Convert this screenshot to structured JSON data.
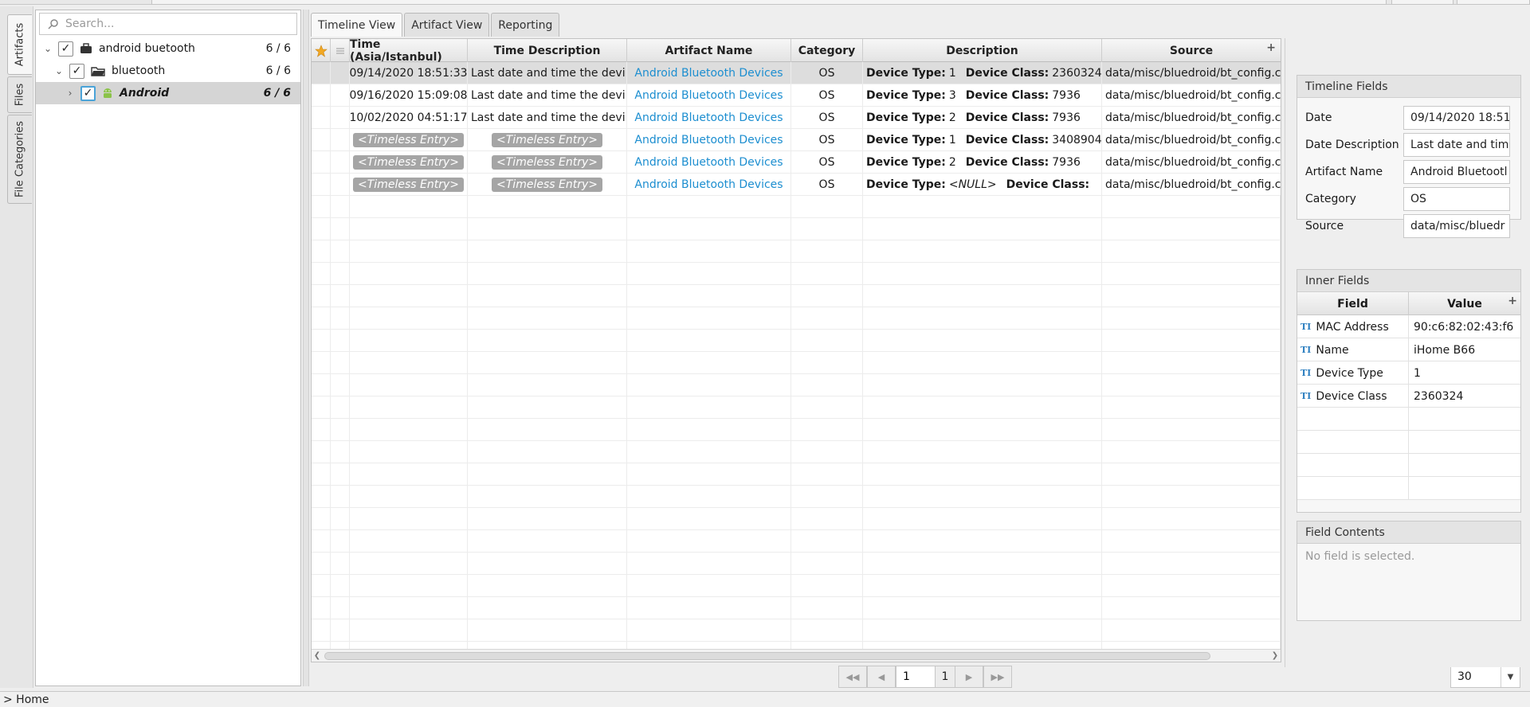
{
  "sidebar_tabs": [
    "Artifacts",
    "Files",
    "File Categories"
  ],
  "search": {
    "placeholder": "Search..."
  },
  "tree": [
    {
      "label": "android buetooth",
      "count": "6 / 6"
    },
    {
      "label": "bluetooth",
      "count": "6 / 6"
    },
    {
      "label": "Android",
      "count": "6 / 6"
    }
  ],
  "tabs": [
    "Timeline View",
    "Artifact View",
    "Reporting"
  ],
  "table": {
    "headers": [
      "Time (Asia/Istanbul)",
      "Time Description",
      "Artifact Name",
      "Category",
      "Description",
      "Source"
    ],
    "rows": [
      {
        "time": "09/14/2020 18:51:33",
        "time_desc": "Last date and time the devi...",
        "artifact": "Android Bluetooth Devices",
        "category": "OS",
        "dt_label": "Device Type:",
        "dt_value": "1",
        "dc_label": "Device Class:",
        "dc_value": "2360324",
        "source": "data/misc/bluedroid/bt_config.co"
      },
      {
        "time": "09/16/2020 15:09:08",
        "time_desc": "Last date and time the devi...",
        "artifact": "Android Bluetooth Devices",
        "category": "OS",
        "dt_label": "Device Type:",
        "dt_value": "3",
        "dc_label": "Device Class:",
        "dc_value": "7936",
        "source": "data/misc/bluedroid/bt_config.co"
      },
      {
        "time": "10/02/2020 04:51:17",
        "time_desc": "Last date and time the devi...",
        "artifact": "Android Bluetooth Devices",
        "category": "OS",
        "dt_label": "Device Type:",
        "dt_value": "2",
        "dc_label": "Device Class:",
        "dc_value": "7936",
        "source": "data/misc/bluedroid/bt_config.co"
      },
      {
        "time": "<Timeless Entry>",
        "time_desc": "<Timeless Entry>",
        "artifact": "Android Bluetooth Devices",
        "category": "OS",
        "dt_label": "Device Type:",
        "dt_value": "1",
        "dc_label": "Device Class:",
        "dc_value": "3408904",
        "source": "data/misc/bluedroid/bt_config.co"
      },
      {
        "time": "<Timeless Entry>",
        "time_desc": "<Timeless Entry>",
        "artifact": "Android Bluetooth Devices",
        "category": "OS",
        "dt_label": "Device Type:",
        "dt_value": "2",
        "dc_label": "Device Class:",
        "dc_value": "7936",
        "source": "data/misc/bluedroid/bt_config.co"
      },
      {
        "time": "<Timeless Entry>",
        "time_desc": "<Timeless Entry>",
        "artifact": "Android Bluetooth Devices",
        "category": "OS",
        "dt_label": "Device Type:",
        "dt_value": "<NULL>",
        "dc_label": "Device Class:",
        "dc_value": "",
        "source": "data/misc/bluedroid/bt_config.co"
      }
    ]
  },
  "pager": {
    "current": "1",
    "total": "1",
    "page_size": "30"
  },
  "timeline_fields": {
    "title": "Timeline Fields",
    "fields": [
      {
        "label": "Date",
        "value": "09/14/2020 18:51"
      },
      {
        "label": "Date Description",
        "value": "Last date and tim"
      },
      {
        "label": "Artifact Name",
        "value": "Android Bluetootl"
      },
      {
        "label": "Category",
        "value": "OS"
      },
      {
        "label": "Source",
        "value": "data/misc/bluedr"
      }
    ]
  },
  "inner_fields": {
    "title": "Inner Fields",
    "headers": [
      "Field",
      "Value"
    ],
    "rows": [
      {
        "field": "MAC Address",
        "value": "90:c6:82:02:43:f6"
      },
      {
        "field": "Name",
        "value": "iHome B66"
      },
      {
        "field": "Device Type",
        "value": "1"
      },
      {
        "field": "Device Class",
        "value": "2360324"
      }
    ]
  },
  "field_contents": {
    "title": "Field Contents",
    "empty": "No field is selected."
  },
  "status": {
    "breadcrumb": "> Home"
  },
  "colors": {
    "link": "#1c8ed0",
    "selected_row": "#dddddd",
    "focus": "#4aa3d8",
    "timeless_pill": "#a5a5a5"
  },
  "icons": {
    "search": "search-icon",
    "case": "briefcase-icon",
    "folder": "folder-icon",
    "android": "android-icon",
    "star": "star-icon",
    "text_field": "text-field-icon"
  }
}
